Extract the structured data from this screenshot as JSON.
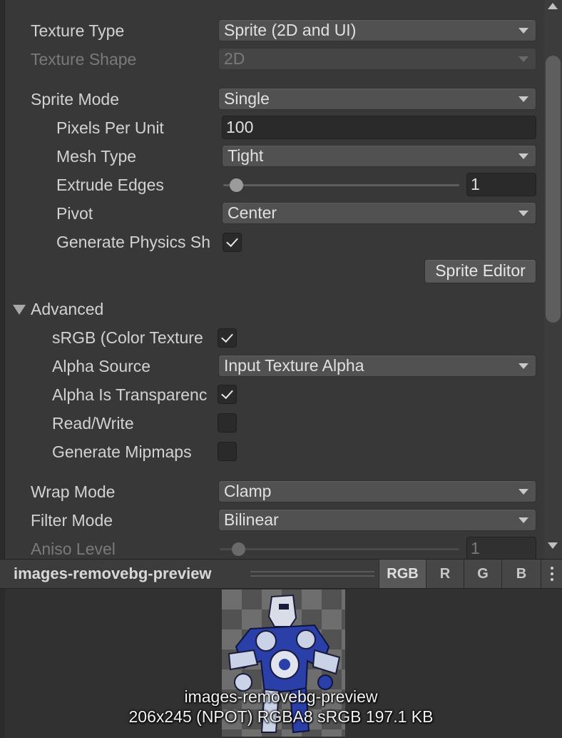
{
  "texture_type": {
    "label": "Texture Type",
    "value": "Sprite (2D and UI)"
  },
  "texture_shape": {
    "label": "Texture Shape",
    "value": "2D"
  },
  "sprite_mode": {
    "label": "Sprite Mode",
    "value": "Single"
  },
  "pixels_per_unit": {
    "label": "Pixels Per Unit",
    "value": "100"
  },
  "mesh_type": {
    "label": "Mesh Type",
    "value": "Tight"
  },
  "extrude_edges": {
    "label": "Extrude Edges",
    "value": "1"
  },
  "pivot": {
    "label": "Pivot",
    "value": "Center"
  },
  "generate_physics_shape": {
    "label": "Generate Physics Sh",
    "checked": true
  },
  "sprite_editor_button": "Sprite Editor",
  "advanced": {
    "label": "Advanced",
    "srgb": {
      "label": "sRGB (Color Texture",
      "checked": true
    },
    "alpha_source": {
      "label": "Alpha Source",
      "value": "Input Texture Alpha"
    },
    "alpha_is_transparency": {
      "label": "Alpha Is Transparenc",
      "checked": true
    },
    "read_write": {
      "label": "Read/Write",
      "checked": false
    },
    "generate_mipmaps": {
      "label": "Generate Mipmaps",
      "checked": false
    }
  },
  "wrap_mode": {
    "label": "Wrap Mode",
    "value": "Clamp"
  },
  "filter_mode": {
    "label": "Filter Mode",
    "value": "Bilinear"
  },
  "aniso_level": {
    "label": "Aniso Level",
    "value": "1"
  },
  "preview": {
    "title": "images-removebg-preview",
    "channels": [
      "RGB",
      "R",
      "G",
      "B"
    ],
    "active_channel": "RGB",
    "image_name": "images-removebg-preview",
    "image_info": "206x245 (NPOT)  RGBA8 sRGB   197.1 KB"
  },
  "colors": {
    "background": "#383838",
    "field": "#515151",
    "text": "#d2d2d2",
    "disabled_text": "#7a7a7a"
  }
}
